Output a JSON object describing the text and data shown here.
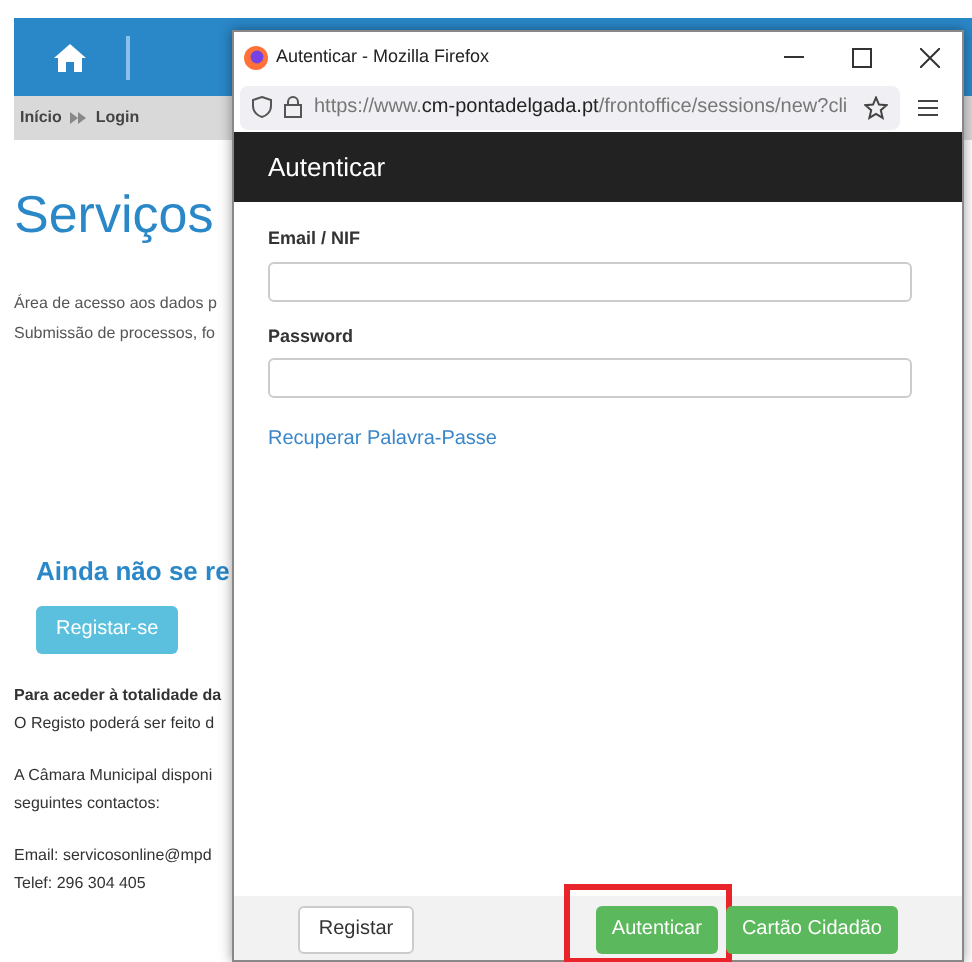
{
  "page": {
    "breadcrumb": [
      "Início",
      "Login"
    ],
    "title": "Serviços",
    "intro": [
      "Área de acesso aos dados p",
      "Submissão de processos, fo"
    ],
    "register_heading": "Ainda não se re",
    "register_button": "Registar-se",
    "notes": [
      {
        "kind": "bold",
        "text": "Para aceder à totalidade da"
      },
      {
        "kind": "plain",
        "text": "O Registo poderá ser feito d"
      },
      {
        "kind": "gap"
      },
      {
        "kind": "plain",
        "text": "A Câmara Municipal disponi"
      },
      {
        "kind": "plain",
        "text": "seguintes contactos:"
      },
      {
        "kind": "gap"
      },
      {
        "kind": "plain",
        "text": "Email: servicosonline@mpd"
      },
      {
        "kind": "plain",
        "text": "Telef: 296 304 405"
      }
    ]
  },
  "popup": {
    "window_title": "Autenticar - Mozilla Firefox",
    "url": {
      "prefix": "https://www.",
      "domain": "cm-pontadelgada.pt",
      "path": "/frontoffice/sessions/new?cli"
    },
    "header": "Autenticar",
    "fields": [
      {
        "label": "Email / NIF"
      },
      {
        "label": "Password"
      }
    ],
    "link": "Recuperar Palavra-Passe",
    "buttons": [
      {
        "label": "Registar",
        "kind": "default",
        "highlighted": false
      },
      {
        "label": "Autenticar",
        "kind": "success",
        "highlighted": true
      },
      {
        "label": "Cartão Cidadão",
        "kind": "success",
        "highlighted": false
      }
    ]
  }
}
